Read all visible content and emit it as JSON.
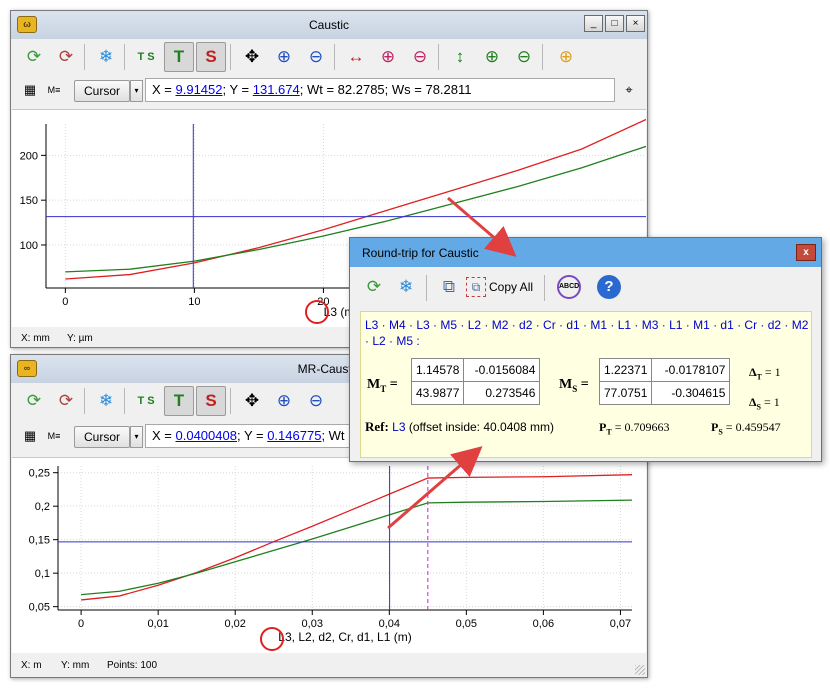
{
  "caustic": {
    "title": "Caustic",
    "app_icon": "ω",
    "buttons": {
      "minimize": "_",
      "maximize": "□",
      "close": "×"
    },
    "cursor_label": "Cursor",
    "dropdown_icon": "▾",
    "readout": {
      "x_label": "X = ",
      "x": "9.91452",
      "y_label": "; Y = ",
      "y": "131.674",
      "rest": "; Wt = 82.2785; Ws = 78.2811"
    },
    "xlabel": "L3 (mm)",
    "status": {
      "x_unit": "X: mm",
      "y_unit": "Y: µm"
    }
  },
  "mr_caustic": {
    "title": "MR-Caustic",
    "app_icon": "∞",
    "cursor_label": "Cursor",
    "readout": {
      "x_label": "X = ",
      "x": "0.0400408",
      "y_label": "; Y = ",
      "y": "0.146775",
      "rest": "; Wt"
    },
    "xlabel": "L3, L2, d2, Cr, d1, L1 (m)",
    "status": {
      "x_unit": "X: m",
      "y_unit": "Y: mm",
      "points": "Points: 100"
    }
  },
  "dialog": {
    "title": "Round-trip for Caustic",
    "close": "x",
    "copy_all": "Copy All",
    "abcd_icon_text": "ABCD",
    "help_icon_text": "?",
    "path": "L3 · M4 · L3 · M5 · L2 · M2 · d2 · Cr · d1 · M1 · L1 · M3 · L1 · M1 · d1 · Cr · d2 · M2 · L2 · M5 :",
    "mt": {
      "label": "M",
      "sub": "T",
      "eq": " =",
      "a": "1.14578",
      "b": "-0.0156084",
      "c": "43.9877",
      "d": "0.273546"
    },
    "ms": {
      "label": "M",
      "sub": "S",
      "eq": " =",
      "a": "1.22371",
      "b": "-0.0178107",
      "c": "77.0751",
      "d": "-0.304615"
    },
    "delta_t": {
      "label": "Δ",
      "sub": "T",
      "value": " = 1"
    },
    "delta_s": {
      "label": "Δ",
      "sub": "S",
      "value": " = 1"
    },
    "ref_label": "Ref:",
    "ref_element": "L3",
    "ref_text": " (offset inside: 40.0408 mm)",
    "pt": {
      "label": "P",
      "sub": "T",
      "value": " = 0.709663"
    },
    "ps": {
      "label": "P",
      "sub": "S",
      "value": " = 0.459547"
    }
  },
  "colors": {
    "curve_t": "#e02020",
    "curve_s": "#208020",
    "cursor": "#3030cc",
    "accent": "#e02020"
  },
  "chart_data": [
    {
      "type": "line",
      "xlabel": "L3 (mm)",
      "xlim": [
        -1.5,
        45
      ],
      "ylim": [
        52,
        235
      ],
      "xticks": [
        0,
        10,
        20
      ],
      "xtick_labels": [
        "0",
        "10",
        "20"
      ],
      "yticks": [
        100,
        150,
        200
      ],
      "ytick_labels": [
        "100",
        "150",
        "200"
      ],
      "grid": true,
      "cursor": {
        "x": 9.91452,
        "y": 131.674
      },
      "series": [
        {
          "color": "#e02020",
          "x": [
            0,
            5,
            10,
            15,
            20,
            25,
            30,
            35,
            40,
            45
          ],
          "y": [
            62,
            67,
            80,
            97,
            117,
            139,
            161,
            183,
            207,
            240
          ]
        },
        {
          "color": "#208020",
          "x": [
            0,
            5,
            10,
            15,
            20,
            25,
            30,
            35,
            40,
            45
          ],
          "y": [
            70,
            73,
            82,
            95,
            110,
            127,
            146,
            165,
            186,
            210
          ]
        }
      ]
    },
    {
      "type": "line",
      "xlabel": "L3, L2, d2, Cr, d1, L1 (m)",
      "xlim": [
        -0.003,
        0.0715
      ],
      "ylim": [
        0.045,
        0.26
      ],
      "xticks": [
        0,
        0.01,
        0.02,
        0.03,
        0.04,
        0.05,
        0.06,
        0.07
      ],
      "xtick_labels": [
        "0",
        "0,01",
        "0,02",
        "0,03",
        "0,04",
        "0,05",
        "0,06",
        "0,07"
      ],
      "yticks": [
        0.05,
        0.1,
        0.15,
        0.2,
        0.25
      ],
      "ytick_labels": [
        "0,05",
        "0,1",
        "0,15",
        "0,2",
        "0,25"
      ],
      "grid": true,
      "cursor": {
        "x": 0.0400408,
        "y": 0.146775
      },
      "marker_x": 0.045,
      "series": [
        {
          "color": "#e02020",
          "x": [
            0,
            0.005,
            0.01,
            0.015,
            0.02,
            0.025,
            0.03,
            0.035,
            0.04,
            0.045,
            0.05,
            0.06,
            0.0715
          ],
          "y": [
            0.06,
            0.066,
            0.082,
            0.101,
            0.123,
            0.147,
            0.17,
            0.194,
            0.218,
            0.242,
            0.243,
            0.244,
            0.247
          ]
        },
        {
          "color": "#208020",
          "x": [
            0,
            0.005,
            0.01,
            0.015,
            0.02,
            0.025,
            0.03,
            0.035,
            0.04,
            0.045,
            0.05,
            0.06,
            0.0715
          ],
          "y": [
            0.068,
            0.073,
            0.085,
            0.1,
            0.117,
            0.134,
            0.151,
            0.169,
            0.187,
            0.205,
            0.206,
            0.207,
            0.209
          ]
        }
      ]
    }
  ]
}
